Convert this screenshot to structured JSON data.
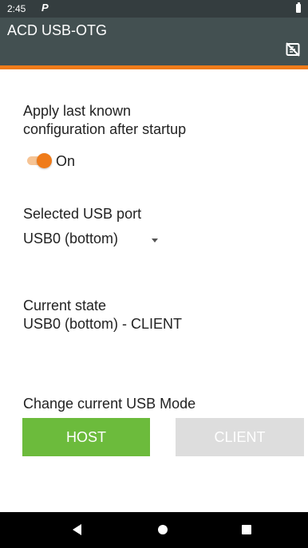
{
  "status_bar": {
    "time": "2:45",
    "notification_letter": "P",
    "battery_icon": "battery-icon"
  },
  "app_bar": {
    "title": "ACD USB-OTG",
    "action_icon": "nfc-off-icon",
    "background_color": "#435051",
    "accent_color": "#ef7b1a"
  },
  "startup_config": {
    "label_line1": "Apply last known",
    "label_line2": "configuration after startup",
    "switch_state": "On",
    "switch_on": true,
    "switch_color": "#ef7b1a"
  },
  "usb_port": {
    "label": "Selected USB port",
    "selected_value": "USB0 (bottom)"
  },
  "current_state": {
    "label": "Current state",
    "value": "USB0 (bottom) - CLIENT"
  },
  "usb_mode": {
    "label": "Change current USB Mode",
    "host_button_label": "HOST",
    "client_button_label": "CLIENT",
    "host_color": "#6cbb3c",
    "client_color": "#dddddd",
    "client_enabled": false
  },
  "nav_bar": {
    "back_icon": "back-triangle-icon",
    "home_icon": "home-circle-icon",
    "recents_icon": "recents-square-icon"
  }
}
